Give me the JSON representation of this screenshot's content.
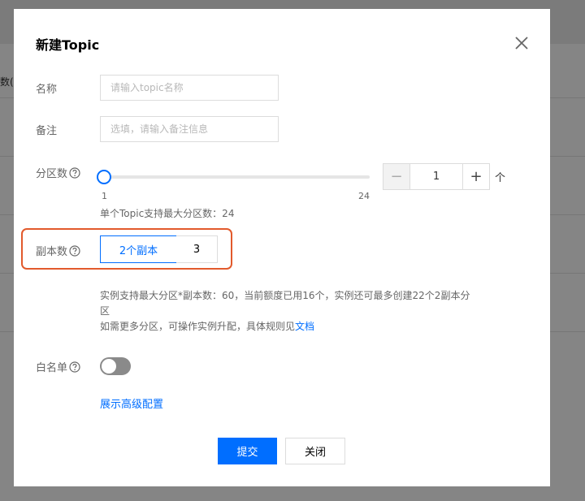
{
  "background": {
    "column_fragment": "数("
  },
  "dialog": {
    "title": "新建Topic",
    "close_icon": "close-icon"
  },
  "form": {
    "name": {
      "label": "名称",
      "placeholder": "请输入topic名称",
      "value": ""
    },
    "remark": {
      "label": "备注",
      "placeholder": "选填，请输入备注信息",
      "value": ""
    },
    "partitions": {
      "label": "分区数",
      "help_icon": "question-circle-icon",
      "slider_min": "1",
      "slider_max": "24",
      "slider_value": 1,
      "stepper_value": "1",
      "minus_label": "−",
      "plus_label": "+",
      "unit": "个",
      "hint": "单个Topic支持最大分区数：24"
    },
    "replicas": {
      "label": "副本数",
      "help_icon": "question-circle-icon",
      "options": [
        "2个副本",
        "3"
      ],
      "selected": "2个副本",
      "hint_line1": "实例支持最大分区*副本数：60，当前额度已用16个，实例还可最多创建22个2副本分",
      "hint_line2": "区",
      "hint_line3_prefix": "如需更多分区，可操作实例升配，具体规则见",
      "hint_link": "文档"
    },
    "whitelist": {
      "label": "白名单",
      "help_icon": "question-circle-icon",
      "enabled": false
    },
    "advanced_link": "展示高级配置"
  },
  "buttons": {
    "submit": "提交",
    "cancel": "关闭"
  },
  "colors": {
    "primary": "#006eff",
    "highlight_border": "#e25a2c",
    "toggle_off": "#8a8a8a"
  }
}
